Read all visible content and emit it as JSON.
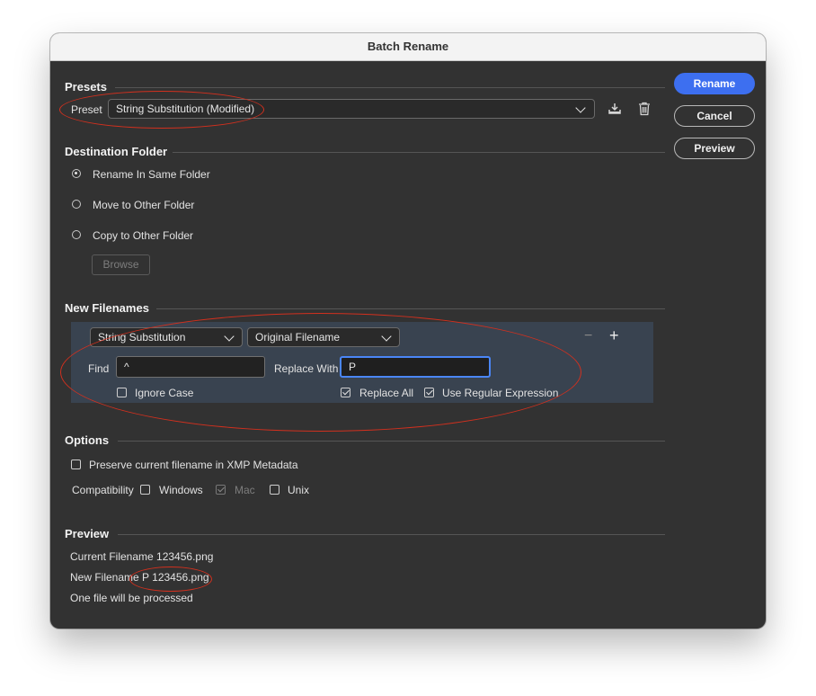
{
  "window": {
    "title": "Batch Rename"
  },
  "buttons": {
    "rename": "Rename",
    "cancel": "Cancel",
    "preview": "Preview"
  },
  "presets": {
    "title": "Presets",
    "label": "Preset",
    "selected": "String Substitution (Modified)",
    "save_icon": "save-preset-icon",
    "delete_icon": "trash-icon"
  },
  "destination": {
    "title": "Destination Folder",
    "options": [
      {
        "label": "Rename In Same Folder",
        "selected": true
      },
      {
        "label": "Move to Other Folder",
        "selected": false
      },
      {
        "label": "Copy to Other Folder",
        "selected": false
      }
    ],
    "browse": "Browse"
  },
  "new_filenames": {
    "title": "New Filenames",
    "type_select": "String Substitution",
    "source_select": "Original Filename",
    "remove_symbol": "−",
    "add_symbol": "+",
    "find_label": "Find",
    "find_value": "^",
    "replace_label": "Replace With",
    "replace_value": "P",
    "ignore_case": {
      "label": "Ignore Case",
      "checked": false
    },
    "replace_all": {
      "label": "Replace All",
      "checked": true
    },
    "use_regex": {
      "label": "Use Regular Expression",
      "checked": true
    }
  },
  "options": {
    "title": "Options",
    "preserve": {
      "label": "Preserve current filename in XMP Metadata",
      "checked": false
    },
    "compat_label": "Compatibility",
    "compat": [
      {
        "label": "Windows",
        "checked": false,
        "disabled": false
      },
      {
        "label": "Mac",
        "checked": true,
        "disabled": true
      },
      {
        "label": "Unix",
        "checked": false,
        "disabled": false
      }
    ]
  },
  "preview": {
    "title": "Preview",
    "current": "Current Filename 123456.png",
    "new_prefix": "New Filename ",
    "new_name": "P 123456.png",
    "count": "One file will be processed"
  },
  "colors": {
    "accent": "#3d6ff0",
    "annotation": "#d2301e",
    "panel": "#394350",
    "background": "#323232"
  }
}
